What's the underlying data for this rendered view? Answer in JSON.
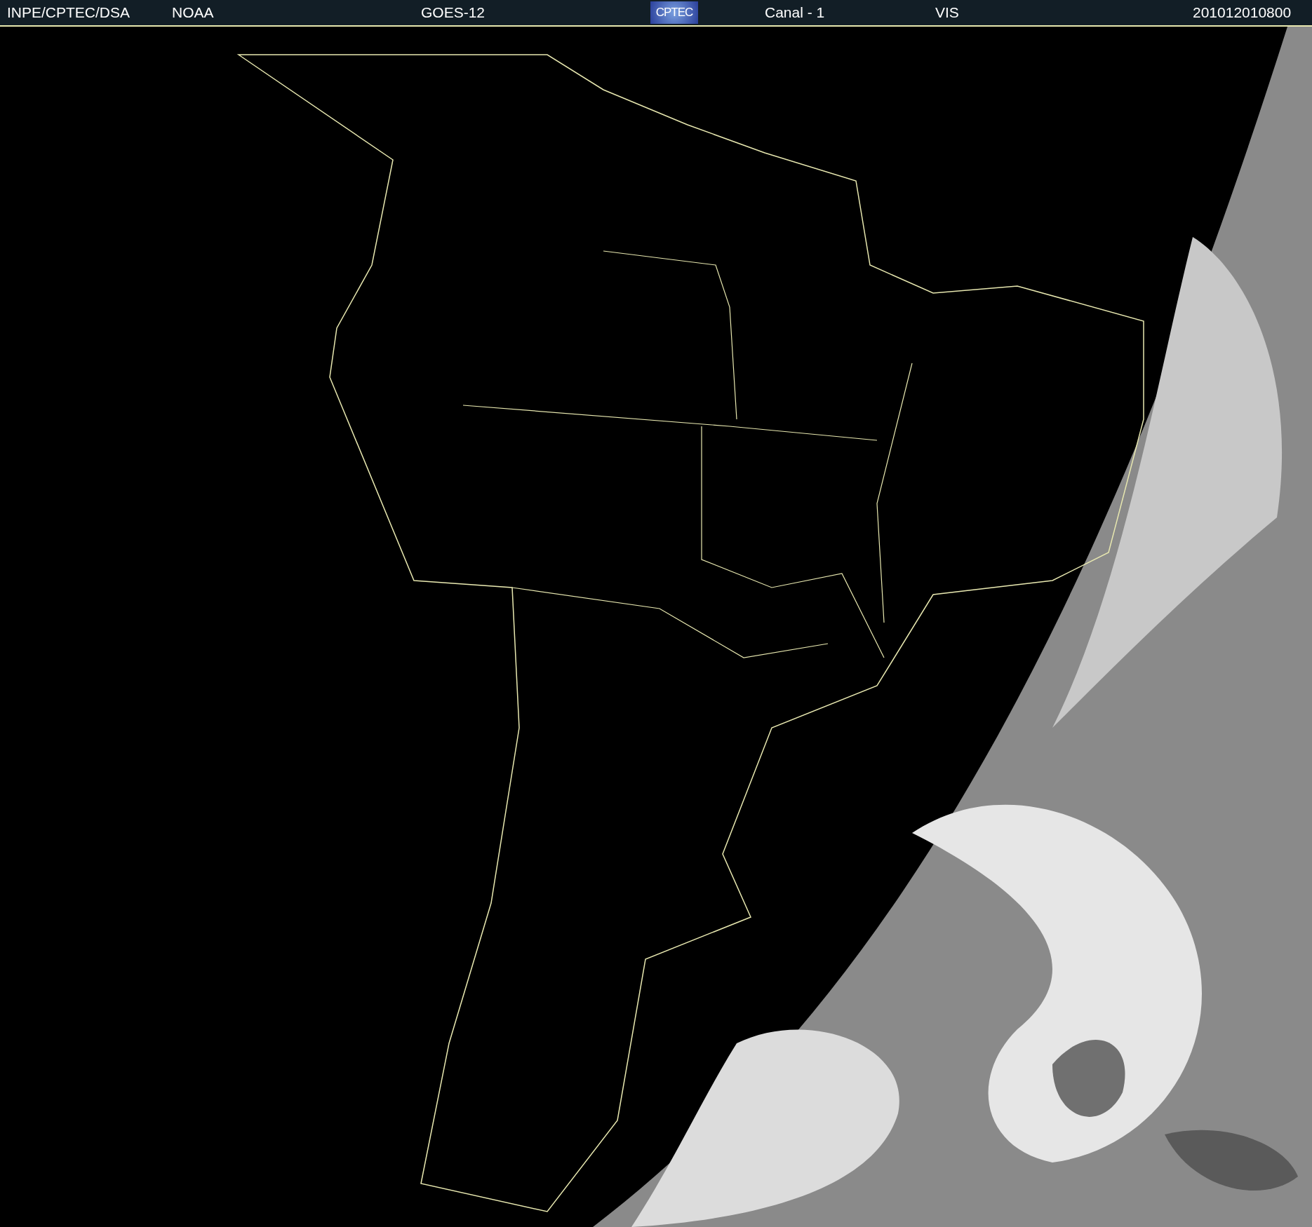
{
  "header": {
    "source": "INPE/CPTEC/DSA",
    "agency": "NOAA",
    "satellite": "GOES-12",
    "logo": "CPTEC",
    "channel": "Canal - 1",
    "band": "VIS",
    "timestamp": "201012010800"
  }
}
